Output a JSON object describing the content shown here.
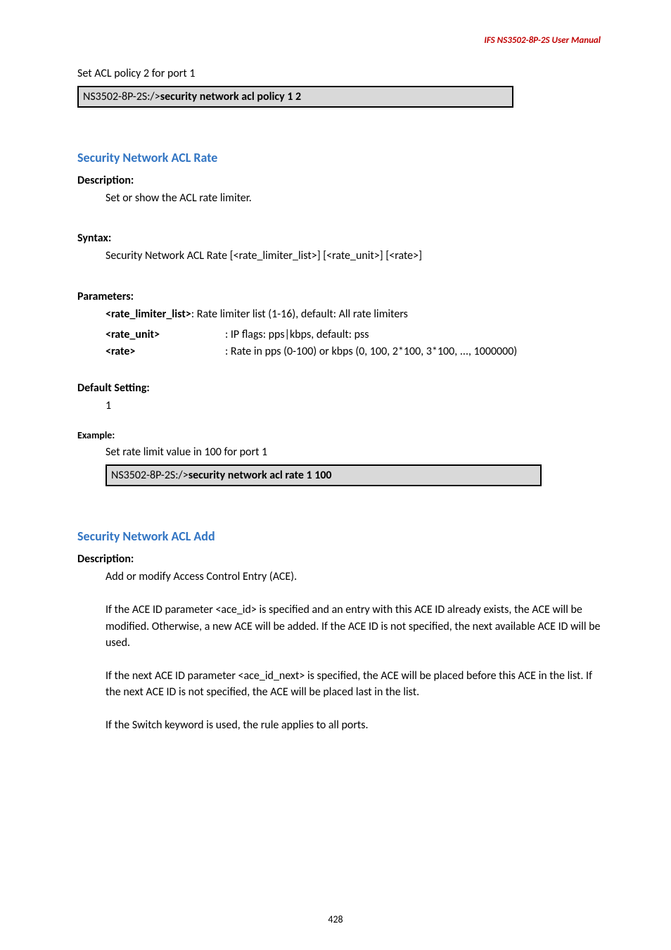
{
  "header": "IFS  NS3502-8P-2S  User  Manual",
  "intro_line": "Set ACL policy 2 for port 1",
  "codebox1_prefix": "NS3502-8P-2S:/>",
  "codebox1_cmd": "security network acl policy 1 2",
  "sec1": {
    "title": "Security Network ACL Rate",
    "desc_label": "Description:",
    "desc_text": "Set or show the ACL rate limiter.",
    "syntax_label": "Syntax:",
    "syntax_text": "Security Network ACL Rate [<rate_limiter_list>] [<rate_unit>] [<rate>]",
    "params_label": "Parameters:",
    "p1_key": "<rate_limiter_list>",
    "p1_val": ": Rate limiter list (1-16), default: All rate limiters",
    "p2_key": "<rate_unit>",
    "p2_val": ": IP flags: pps|kbps, default: pss",
    "p3_key": "<rate>",
    "p3_val": ": Rate in pps (0-100) or kbps (0, 100, 2*100, 3*100, ..., 1000000)",
    "default_label": "Default Setting:",
    "default_val": "1",
    "example_label": "Example:",
    "example_text": "Set rate limit value in 100 for port 1",
    "codebox_prefix": "NS3502-8P-2S:/>",
    "codebox_cmd": "security network acl rate 1 100"
  },
  "sec2": {
    "title": "Security Network ACL Add",
    "desc_label": "Description:",
    "desc_text": "Add or modify Access Control Entry (ACE).",
    "para1": "If the ACE ID parameter <ace_id> is specified and an entry with this ACE ID already exists, the ACE will be modified. Otherwise, a new ACE will be added. If the ACE ID is not specified, the next available ACE ID will be used.",
    "para2": "If the next ACE ID parameter <ace_id_next> is specified, the ACE will be placed before this ACE in the list. If the next ACE ID is not specified, the ACE will be placed last in the list.",
    "para3": "If the Switch keyword is used, the rule applies to all ports."
  },
  "page_number": "428"
}
